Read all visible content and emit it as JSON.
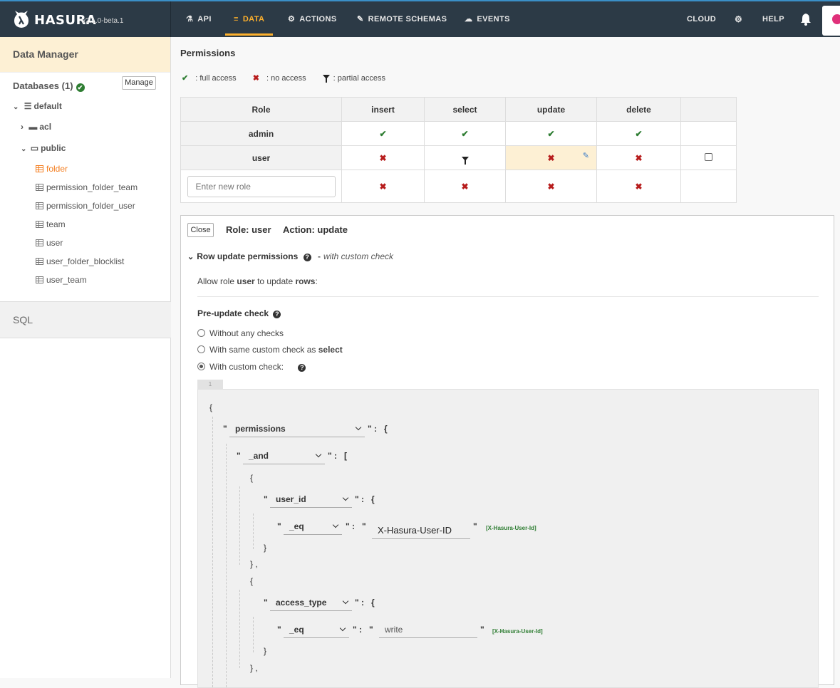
{
  "nav": {
    "brand": "HASURA",
    "version": "v2.1.0-beta.1",
    "items": [
      {
        "label": "API",
        "icon": "flask-icon"
      },
      {
        "label": "DATA",
        "icon": "database-icon"
      },
      {
        "label": "ACTIONS",
        "icon": "gears-icon"
      },
      {
        "label": "REMOTE SCHEMAS",
        "icon": "plug-icon"
      },
      {
        "label": "EVENTS",
        "icon": "cloud-icon"
      }
    ],
    "cloud": "CLOUD",
    "help": "HELP",
    "accent": "#fdb02c"
  },
  "sidebar": {
    "title": "Data Manager",
    "databases": "Databases (1)",
    "manage": "Manage",
    "default_db": "default",
    "schemas": [
      "acl",
      "public"
    ],
    "tables": [
      "folder",
      "permission_folder_team",
      "permission_folder_user",
      "team",
      "user",
      "user_folder_blocklist",
      "user_team"
    ],
    "sql": "SQL"
  },
  "permissions": {
    "title": "Permissions",
    "legend": {
      "full": ": full access",
      "none": ": no access",
      "partial": ": partial access"
    },
    "columns": [
      "Role",
      "insert",
      "select",
      "update",
      "delete"
    ],
    "rows": [
      {
        "role": "admin",
        "insert": "full",
        "select": "full",
        "update": "full",
        "delete": "full"
      },
      {
        "role": "user",
        "insert": "none",
        "select": "partial",
        "update": "none",
        "delete": "none"
      }
    ],
    "new_role_placeholder": "Enter new role"
  },
  "editor": {
    "close": "Close",
    "role": "Role: user",
    "action": "Action: update",
    "section": "Row update permissions",
    "custom_note": "with custom check",
    "allow_prefix": "Allow role",
    "allow_role": "user",
    "allow_mid": "to update",
    "allow_obj": "rows",
    "allow_suffix": ":",
    "pre_check": "Pre-update check",
    "options": [
      "Without any checks",
      "With same custom check as",
      "With custom check:"
    ],
    "option_select_word": "select",
    "selected_option": 2,
    "line_no": "1",
    "code": {
      "k1": "permissions",
      "k2": "_and",
      "k3": "user_id",
      "k4": "_eq",
      "v4": "X-Hasura-User-ID",
      "s4": "[X-Hasura-User-Id]",
      "k5": "access_type",
      "k6": "_eq",
      "v6": "write",
      "s6": "[X-Hasura-User-Id]"
    }
  }
}
